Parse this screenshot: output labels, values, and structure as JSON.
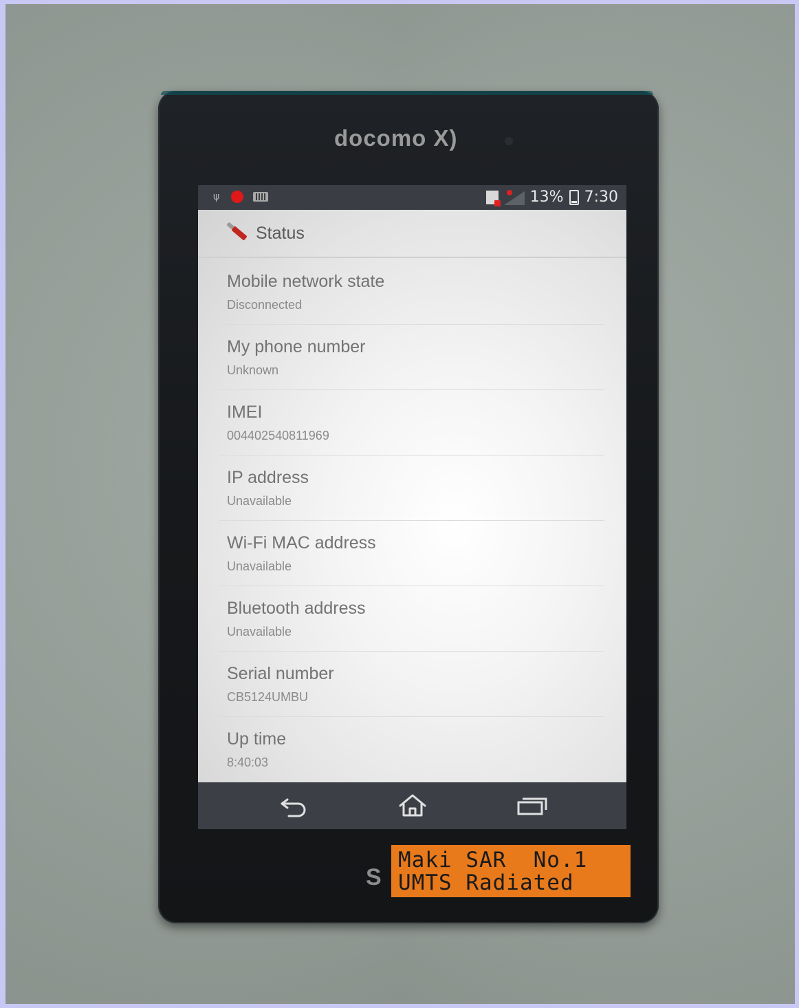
{
  "phone": {
    "carrier_logo": "docomo X)",
    "brand_partial": "S"
  },
  "statusbar": {
    "left_icons": [
      "usb-debug-icon",
      "record-icon",
      "sd-card-icon"
    ],
    "right_icons": [
      "notification-doc-icon",
      "signal-icon",
      "battery-icon"
    ],
    "battery_percent": "13%",
    "time": "7:30"
  },
  "actionbar": {
    "icon": "settings-wrench-icon",
    "title": "Status"
  },
  "items": [
    {
      "title": "Mobile network state",
      "value": "Disconnected"
    },
    {
      "title": "My phone number",
      "value": "Unknown"
    },
    {
      "title": "IMEI",
      "value": "004402540811969"
    },
    {
      "title": "IP address",
      "value": "Unavailable"
    },
    {
      "title": "Wi-Fi MAC address",
      "value": "Unavailable"
    },
    {
      "title": "Bluetooth address",
      "value": "Unavailable"
    },
    {
      "title": "Serial number",
      "value": "CB5124UMBU"
    },
    {
      "title": "Up time",
      "value": "8:40:03"
    }
  ],
  "navbar": {
    "back_icon": "back-icon",
    "home_icon": "home-icon",
    "recent_icon": "recent-apps-icon"
  },
  "sticker": {
    "line1": "Maki SAR  No.1",
    "line2": "UMTS Radiated"
  },
  "colors": {
    "sticker_bg": "#e87a1c",
    "notification_red": "#e01818",
    "statusbar_bg": "#3a3d44",
    "navbar_bg": "#3c3f46"
  }
}
